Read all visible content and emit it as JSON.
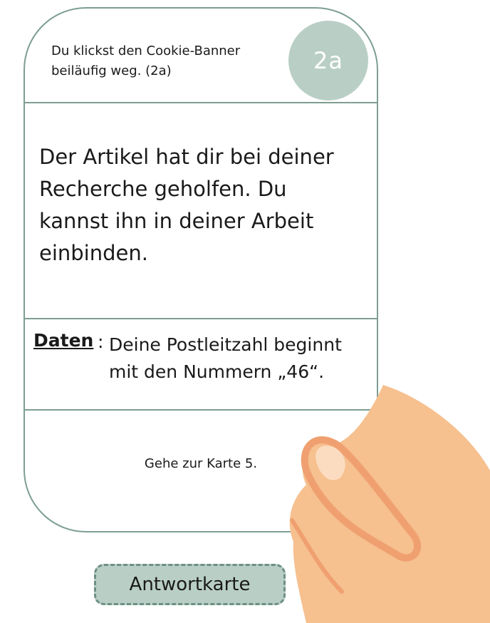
{
  "card": {
    "header_text_line1": "Du klickst den Cookie-Banner",
    "header_text_line2": "beiläufig weg. (2a)",
    "badge": "2a",
    "body_line1": "Der Artikel hat dir bei deiner",
    "body_line2": "Recherche geholfen. Du",
    "body_line3": "kannst ihn in deiner Arbeit",
    "body_line4": "einbinden.",
    "data_label": "Daten",
    "data_colon": ":",
    "data_line1": "Deine Postleitzahl beginnt",
    "data_line2": "mit  den Nummern „46“.",
    "footer": "Gehe zur Karte 5."
  },
  "answer_button": {
    "label": "Antwortkarte"
  },
  "colors": {
    "card_border": "#7d9e92",
    "badge_fill": "#b9cfc6",
    "hand_skin": "#f6c08f",
    "hand_outline": "#f0a070"
  },
  "icons": {
    "hand": "hand-holding-card-icon"
  }
}
